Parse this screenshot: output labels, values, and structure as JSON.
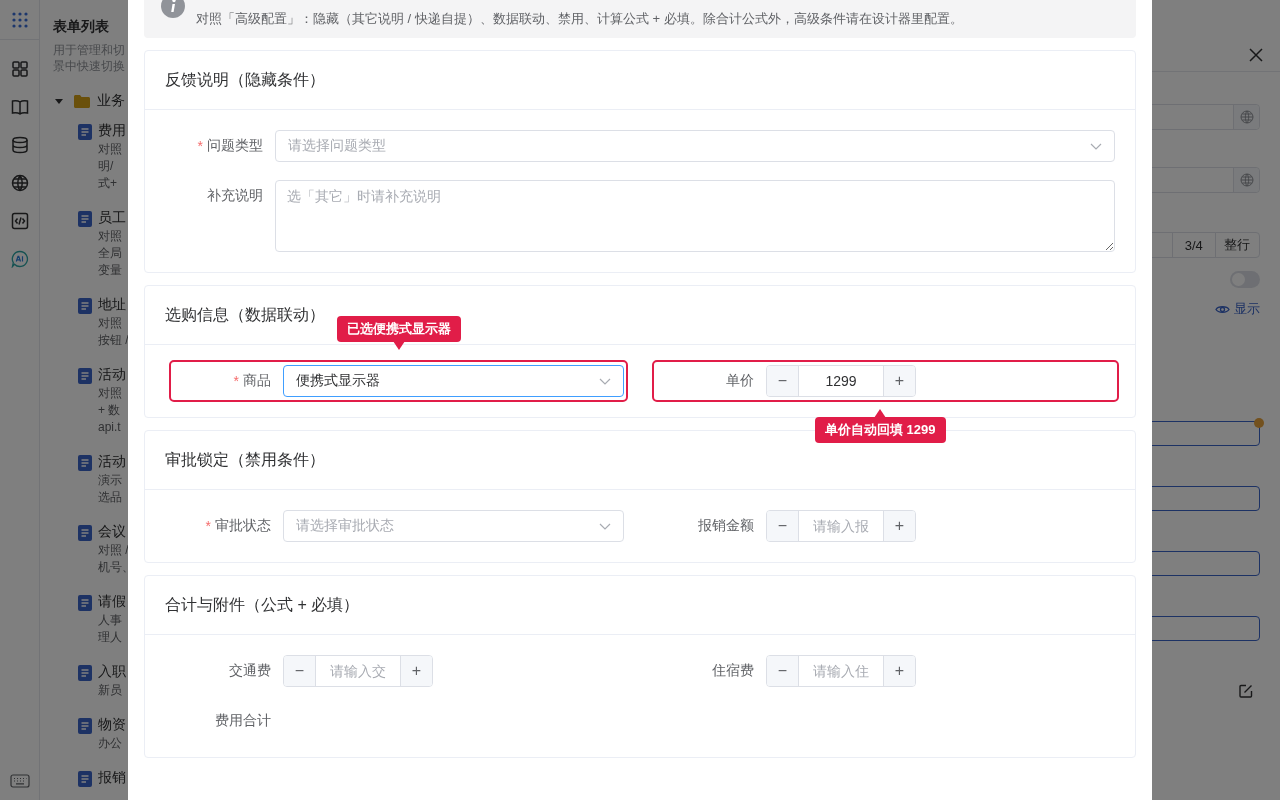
{
  "list_panel": {
    "title": "表单列表",
    "description": [
      "用于管理和切",
      "景中快速切换"
    ],
    "folder": {
      "label": "业务",
      "expanded": true
    },
    "items": [
      {
        "title": "费用",
        "lines": [
          "对照",
          "明/",
          "式+"
        ]
      },
      {
        "title": "员工",
        "lines": [
          "对照",
          "全局",
          "变量"
        ]
      },
      {
        "title": "地址",
        "lines": [
          "对照",
          "按钮 /"
        ]
      },
      {
        "title": "活动",
        "lines": [
          "对照",
          "+ 数",
          "api.t"
        ]
      },
      {
        "title": "活动",
        "lines": [
          "演示",
          "选品"
        ]
      },
      {
        "title": "会议",
        "lines": [
          "对照 /",
          "机号、"
        ]
      },
      {
        "title": "请假",
        "lines": [
          "人事",
          "理人"
        ]
      },
      {
        "title": "入职",
        "lines": [
          "新员"
        ]
      },
      {
        "title": "物资",
        "lines": [
          "办公"
        ]
      },
      {
        "title": "报销"
      }
    ]
  },
  "settings_panel": {
    "width_options": [
      {
        "label": "3/4",
        "selected": false
      },
      {
        "label": "整行",
        "selected": false
      }
    ],
    "toggle": {
      "on": false
    },
    "visibility_link": "显示"
  },
  "dialog": {
    "notice": "对照「高级配置」：隐藏（其它说明 / 快递自提）、数据联动、禁用、计算公式 + 必填。除合计公式外，高级条件请在设计器里配置。",
    "sections": [
      {
        "title": "反馈说明（隐藏条件）",
        "fields": [
          {
            "kind": "select",
            "label": "问题类型",
            "required_mark": "*",
            "placeholder": "请选择问题类型",
            "focused": false
          },
          {
            "kind": "textarea",
            "label": "补充说明",
            "placeholder": "选「其它」时请补充说明"
          }
        ]
      },
      {
        "title": "选购信息（数据联动）",
        "fields": [
          {
            "kind": "select",
            "label": "商品",
            "required_mark": "*",
            "value": "便携式显示器",
            "focused": true,
            "highlighted": true,
            "callout": "已选便携式显示器"
          },
          {
            "kind": "stepper",
            "label": "单价",
            "value": "1299",
            "minus": "−",
            "plus": "+",
            "highlighted": true,
            "callout": "单价自动回填 1299"
          }
        ]
      },
      {
        "title": "审批锁定（禁用条件）",
        "fields": [
          {
            "kind": "select",
            "label": "审批状态",
            "required_mark": "*",
            "placeholder": "请选择审批状态",
            "focused": false
          },
          {
            "kind": "stepper",
            "label": "报销金额",
            "placeholder": "请输入报",
            "minus": "−",
            "plus": "+"
          }
        ]
      },
      {
        "title": "合计与附件（公式 + 必填）",
        "fields": [
          {
            "kind": "stepper",
            "label": "交通费",
            "placeholder": "请输入交",
            "minus": "−",
            "plus": "+"
          },
          {
            "kind": "stepper",
            "label": "住宿费",
            "placeholder": "请输入住",
            "minus": "−",
            "plus": "+"
          },
          {
            "kind": "text",
            "label": "费用合计"
          }
        ]
      }
    ]
  }
}
